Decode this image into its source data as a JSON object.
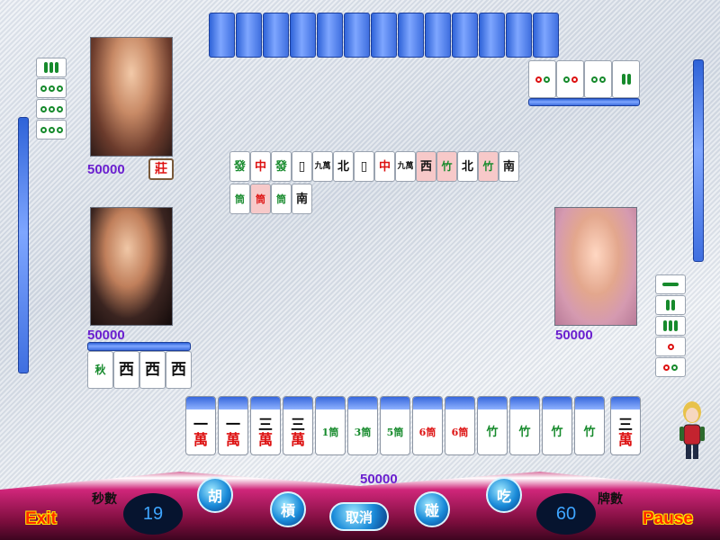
{
  "players": {
    "top_left": {
      "score": "50000",
      "dealer_badge": "莊"
    },
    "left": {
      "score": "50000"
    },
    "right": {
      "score": "50000"
    },
    "self": {
      "score": "50000"
    }
  },
  "discards": {
    "row1": [
      "發",
      "中",
      "發",
      "▯",
      "九萬",
      "北",
      "▯",
      "中",
      "九萬",
      "西",
      "竹",
      "北",
      "竹",
      "南"
    ],
    "row2": [
      "筒",
      "筒",
      "筒",
      "南"
    ]
  },
  "left_meld": [
    "秋",
    "西",
    "西",
    "西"
  ],
  "right_opponent_exposed": [
    "竹",
    "竹",
    "竹",
    "花",
    "花"
  ],
  "top_opponent_exposed": [
    "花",
    "筒",
    "筒",
    "花"
  ],
  "top_left_exposed": [
    "花",
    "筒",
    "筒",
    "筒"
  ],
  "hand": [
    {
      "t": "一",
      "b": "萬"
    },
    {
      "t": "一",
      "b": "萬"
    },
    {
      "t": "三",
      "b": "萬"
    },
    {
      "t": "三",
      "b": "萬"
    },
    {
      "t": "1筒",
      "b": ""
    },
    {
      "t": "3筒",
      "b": ""
    },
    {
      "t": "5筒",
      "b": ""
    },
    {
      "t": "6筒",
      "b": ""
    },
    {
      "t": "6筒",
      "b": ""
    },
    {
      "t": "竹",
      "b": ""
    },
    {
      "t": "竹",
      "b": ""
    },
    {
      "t": "竹",
      "b": ""
    },
    {
      "t": "竹",
      "b": ""
    },
    {
      "t": "三",
      "b": "萬"
    }
  ],
  "controls": {
    "timer_label": "秒數",
    "timer_value": "19",
    "tiles_label": "牌數",
    "tiles_value": "60",
    "exit": "Exit",
    "pause": "Pause",
    "btn_hu": "胡",
    "btn_gang": "槓",
    "btn_cancel": "取消",
    "btn_peng": "碰",
    "btn_chi": "吃"
  }
}
